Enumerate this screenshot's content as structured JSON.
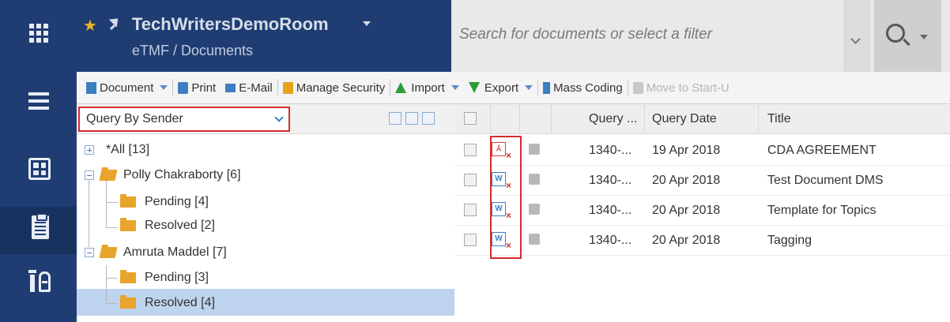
{
  "header": {
    "room_name": "TechWritersDemoRoom",
    "breadcrumb": "eTMF / Documents",
    "search_placeholder": "Search for documents or select a filter"
  },
  "rail": {
    "icons": [
      "apps-grid-icon",
      "hamburger-menu-icon",
      "dashboard-icon",
      "clipboard-icon",
      "tools-icon"
    ]
  },
  "toolbar": {
    "document": "Document",
    "print": "Print",
    "email": "E-Mail",
    "manage_security": "Manage Security",
    "import": "Import",
    "export": "Export",
    "mass_coding": "Mass Coding",
    "move_to_start": "Move to Start-U"
  },
  "tree": {
    "query_select": "Query By Sender",
    "nodes": [
      {
        "label": "*All [13]"
      },
      {
        "label": "Polly Chakraborty [6]"
      },
      {
        "label": "Pending [4]"
      },
      {
        "label": "Resolved [2]"
      },
      {
        "label": "Amruta Maddel [7]"
      },
      {
        "label": "Pending [3]"
      },
      {
        "label": "Resolved [4]"
      }
    ]
  },
  "grid": {
    "columns": [
      "Query ...",
      "Query Date",
      "Title"
    ],
    "rows": [
      {
        "type": "PDF",
        "query": "1340-...",
        "date": "19 Apr 2018",
        "title": "CDA AGREEMENT"
      },
      {
        "type": "W",
        "query": "1340-...",
        "date": "20 Apr 2018",
        "title": "Test Document DMS"
      },
      {
        "type": "W",
        "query": "1340-...",
        "date": "20 Apr 2018",
        "title": "Template for Topics"
      },
      {
        "type": "W",
        "query": "1340-...",
        "date": "20 Apr 2018",
        "title": "Tagging"
      }
    ]
  },
  "colors": {
    "nav": "#1f3d73",
    "highlight_red": "#d42b2b",
    "selected_row": "#bed3ee",
    "folder": "#e8a42b"
  }
}
